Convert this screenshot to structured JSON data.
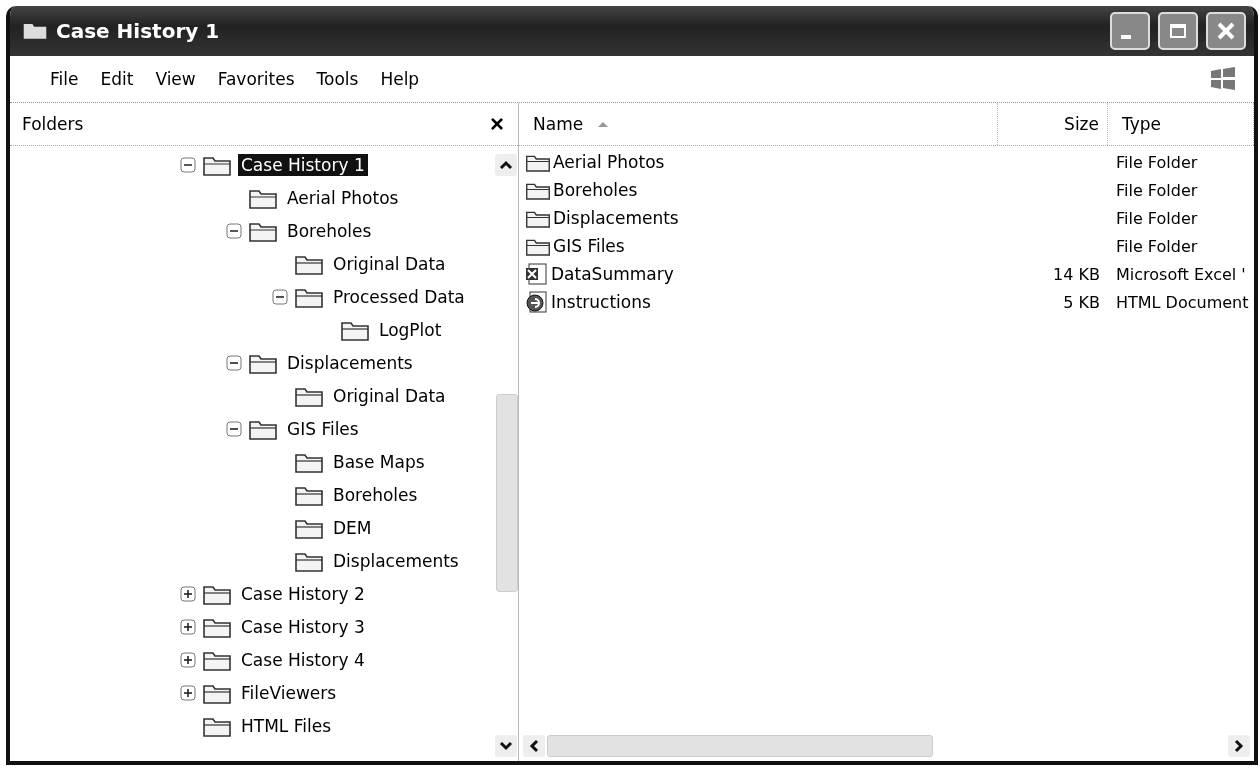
{
  "window": {
    "title": "Case History 1"
  },
  "menu": [
    "File",
    "Edit",
    "View",
    "Favorites",
    "Tools",
    "Help"
  ],
  "folders_pane": {
    "title": "Folders",
    "close": "×",
    "tree": [
      {
        "label": "Case History 1",
        "selected": true,
        "expanded": true,
        "children": [
          {
            "label": "Aerial Photos",
            "selected": false
          },
          {
            "label": "Boreholes",
            "selected": false,
            "expanded": true,
            "children": [
              {
                "label": "Original Data",
                "selected": false
              },
              {
                "label": "Processed Data",
                "selected": false,
                "expanded": true,
                "children": [
                  {
                    "label": "LogPlot",
                    "selected": false
                  }
                ]
              }
            ]
          },
          {
            "label": "Displacements",
            "selected": false,
            "expanded": true,
            "children": [
              {
                "label": "Original Data",
                "selected": false
              }
            ]
          },
          {
            "label": "GIS Files",
            "selected": false,
            "expanded": true,
            "children": [
              {
                "label": "Base Maps",
                "selected": false
              },
              {
                "label": "Boreholes",
                "selected": false
              },
              {
                "label": "DEM",
                "selected": false
              },
              {
                "label": "Displacements",
                "selected": false
              }
            ]
          }
        ]
      },
      {
        "label": "Case History 2",
        "selected": false,
        "expanded": false
      },
      {
        "label": "Case History 3",
        "selected": false,
        "expanded": false
      },
      {
        "label": "Case History 4",
        "selected": false,
        "expanded": false
      },
      {
        "label": "FileViewers",
        "selected": false,
        "expanded": false
      },
      {
        "label": "HTML Files",
        "selected": false
      }
    ]
  },
  "file_list": {
    "columns": [
      "Name",
      "Size",
      "Type"
    ],
    "rows": [
      {
        "kind": "folder",
        "name": "Aerial Photos",
        "type": "File Folder"
      },
      {
        "kind": "folder",
        "name": "Boreholes",
        "type": "File Folder"
      },
      {
        "kind": "folder",
        "name": "Displacements",
        "type": "File Folder"
      },
      {
        "kind": "folder",
        "name": "GIS Files",
        "type": "File Folder"
      },
      {
        "kind": "excel",
        "name": "DataSummary",
        "size": "14 KB",
        "type": "Microsoft Excel '"
      },
      {
        "kind": "html",
        "name": "Instructions",
        "size": "5 KB",
        "type": "HTML Document"
      }
    ]
  }
}
